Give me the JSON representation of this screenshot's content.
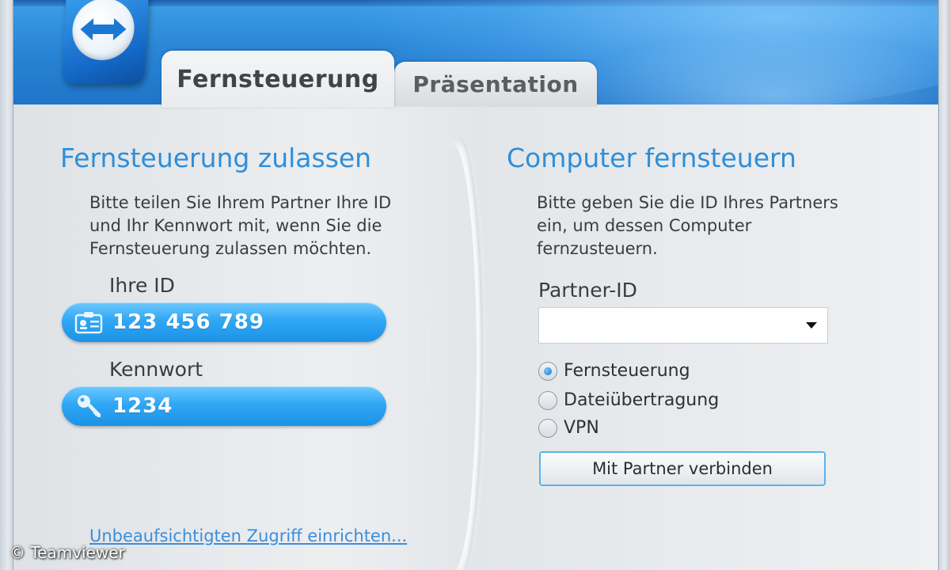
{
  "tabs": [
    {
      "label": "Fernsteuerung",
      "active": true
    },
    {
      "label": "Präsentation",
      "active": false
    }
  ],
  "left": {
    "title": "Fernsteuerung zulassen",
    "desc_lines": [
      "Bitte teilen Sie Ihrem Partner Ihre ID",
      "und Ihr Kennwort mit, wenn Sie die",
      "Fernsteuerung zulassen möchten."
    ],
    "id_label": "Ihre ID",
    "id_value": "123 456 789",
    "password_label": "Kennwort",
    "password_value": "1234",
    "unattended_link": "Unbeaufsichtigten Zugriff einrichten..."
  },
  "right": {
    "title": "Computer fernsteuern",
    "desc_lines": [
      "Bitte geben Sie die ID Ihres Partners",
      "ein, um dessen Computer",
      "fernzusteuern."
    ],
    "partner_id_label": "Partner-ID",
    "partner_id_value": "",
    "modes": [
      {
        "label": "Fernsteuerung",
        "selected": true
      },
      {
        "label": "Dateiübertragung",
        "selected": false
      },
      {
        "label": "VPN",
        "selected": false
      }
    ],
    "connect_button": "Mit Partner verbinden"
  },
  "watermark": "© Teamviewer",
  "colors": {
    "accent_blue": "#2f8ed8",
    "header_blue": "#2a86d6",
    "pill_blue": "#2fa7f5",
    "link_blue": "#3a8edc"
  },
  "icons": {
    "logo": "teamviewer-logo-icon",
    "id": "id-card-icon",
    "password": "key-icon",
    "dropdown": "chevron-down-icon"
  }
}
